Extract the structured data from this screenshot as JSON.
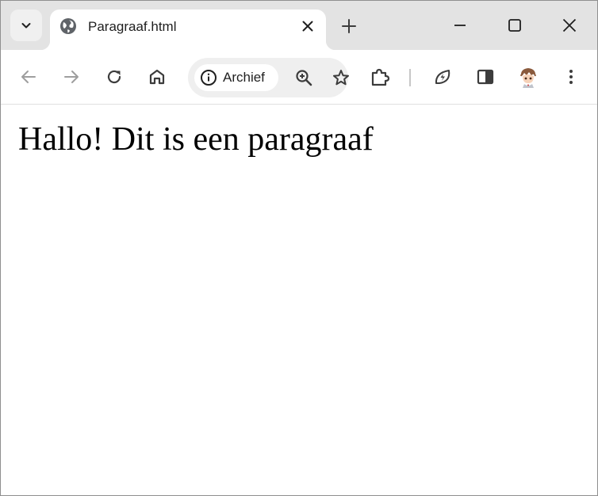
{
  "tabstrip": {
    "tab_search_icon": "chevron-down-icon",
    "active_tab": {
      "title": "Paragraaf.html",
      "favicon": "globe-icon",
      "close_icon": "close-icon"
    },
    "new_tab_icon": "plus-icon",
    "window_controls": [
      "minimize-icon",
      "maximize-icon",
      "close-icon"
    ]
  },
  "toolbar": {
    "back_icon": "arrow-left-icon",
    "forward_icon": "arrow-right-icon",
    "reload_icon": "reload-icon",
    "home_icon": "home-icon",
    "site_info": {
      "icon": "info-icon",
      "label": "Archief"
    },
    "zoom_icon": "zoom-in-icon",
    "bookmark_icon": "star-icon",
    "extensions_icon": "puzzle-icon",
    "performance_icon": "leaf-lightning-icon",
    "side_panel_icon": "side-panel-icon",
    "profile_icon": "avatar-icon",
    "menu_icon": "more-vert-icon"
  },
  "page": {
    "paragraph": "Hallo! Dit is een paragraaf"
  },
  "colors": {
    "tabstrip_bg": "#e3e3e3",
    "toolbar_bg": "#ffffff",
    "omnibox_bg": "#efefef",
    "icon": "#3c3c3c",
    "icon_disabled": "#9e9e9e"
  }
}
